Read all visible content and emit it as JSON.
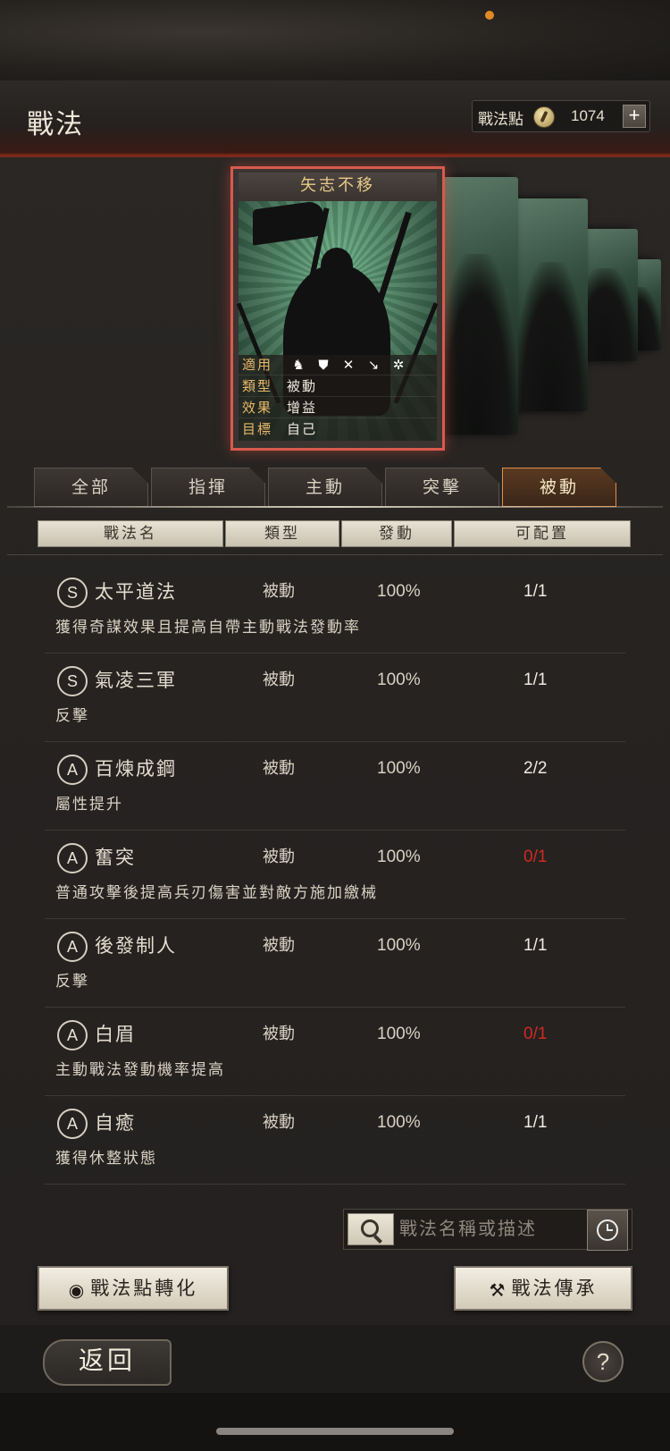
{
  "header": {
    "title": "戰法",
    "points_label": "戰法點",
    "points_value": "1074",
    "add_label": "+"
  },
  "featured_card": {
    "name": "矢志不移",
    "rows": [
      {
        "key": "適用",
        "value": ""
      },
      {
        "key": "類型",
        "value": "被動"
      },
      {
        "key": "效果",
        "value": "增益"
      },
      {
        "key": "目標",
        "value": "自己"
      }
    ],
    "arm_icons": [
      "cavalry-icon",
      "shield-icon",
      "bow-icon",
      "spear-icon",
      "wheel-icon"
    ]
  },
  "tabs": [
    {
      "label": "全部",
      "active": false
    },
    {
      "label": "指揮",
      "active": false
    },
    {
      "label": "主動",
      "active": false
    },
    {
      "label": "突擊",
      "active": false
    },
    {
      "label": "被動",
      "active": true
    }
  ],
  "columns": {
    "name": "戰法名",
    "type": "類型",
    "rate": "發動",
    "config": "可配置"
  },
  "tactics": [
    {
      "grade": "S",
      "name": "太平道法",
      "type": "被動",
      "rate": "100%",
      "count": "1/1",
      "count_color": "#f0ebe0",
      "desc": "獲得奇謀效果且提高自帶主動戰法發動率"
    },
    {
      "grade": "S",
      "name": "氣凌三軍",
      "type": "被動",
      "rate": "100%",
      "count": "1/1",
      "count_color": "#f0ebe0",
      "desc": "反擊"
    },
    {
      "grade": "A",
      "name": "百煉成鋼",
      "type": "被動",
      "rate": "100%",
      "count": "2/2",
      "count_color": "#f0ebe0",
      "desc": "屬性提升"
    },
    {
      "grade": "A",
      "name": "奮突",
      "type": "被動",
      "rate": "100%",
      "count": "0/1",
      "count_color": "#d02a20",
      "desc": "普通攻擊後提高兵刃傷害並對敵方施加繳械"
    },
    {
      "grade": "A",
      "name": "後發制人",
      "type": "被動",
      "rate": "100%",
      "count": "1/1",
      "count_color": "#f0ebe0",
      "desc": "反擊"
    },
    {
      "grade": "A",
      "name": "白眉",
      "type": "被動",
      "rate": "100%",
      "count": "0/1",
      "count_color": "#d02a20",
      "desc": "主動戰法發動機率提高"
    },
    {
      "grade": "A",
      "name": "自癒",
      "type": "被動",
      "rate": "100%",
      "count": "1/1",
      "count_color": "#f0ebe0",
      "desc": "獲得休整狀態"
    }
  ],
  "search": {
    "placeholder": "戰法名稱或描述"
  },
  "buttons": {
    "convert": "戰法點轉化",
    "inherit": "戰法傳承",
    "back": "返回",
    "help": "?"
  }
}
